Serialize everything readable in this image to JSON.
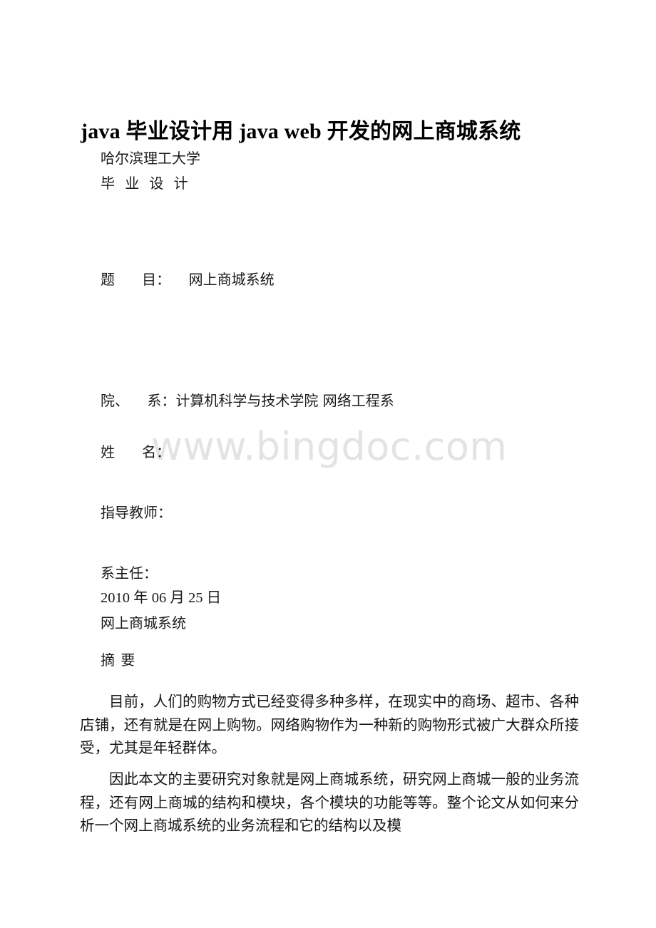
{
  "document": {
    "title": "java 毕业设计用 java web 开发的网上商城系统",
    "watermark": "www.bingdoc.com",
    "cover": {
      "university": "哈尔滨理工大学",
      "subtitle": "毕  业  设  计",
      "topic_line": "题      目：    网上商城系统",
      "department_line": "院、    系：计算机科学与技术学院 网络工程系",
      "name_line": "姓      名：",
      "advisor_line": "指导教师：",
      "department_head_line": "系主任：",
      "date_line": "2010 年 06 月 25 日",
      "system_name": "网上商城系统",
      "abstract_heading": "摘 要"
    },
    "paragraphs": [
      "目前，人们的购物方式已经变得多种多样，在现实中的商场、超市、各种店铺，还有就是在网上购物。网络购物作为一种新的购物形式被广大群众所接受，尤其是年轻群体。",
      "因此本文的主要研究对象就是网上商城系统，研究网上商城一般的业务流程，还有网上商城的结构和模块，各个模块的功能等等。整个论文从如何来分析一个网上商城系统的业务流程和它的结构以及模"
    ]
  }
}
